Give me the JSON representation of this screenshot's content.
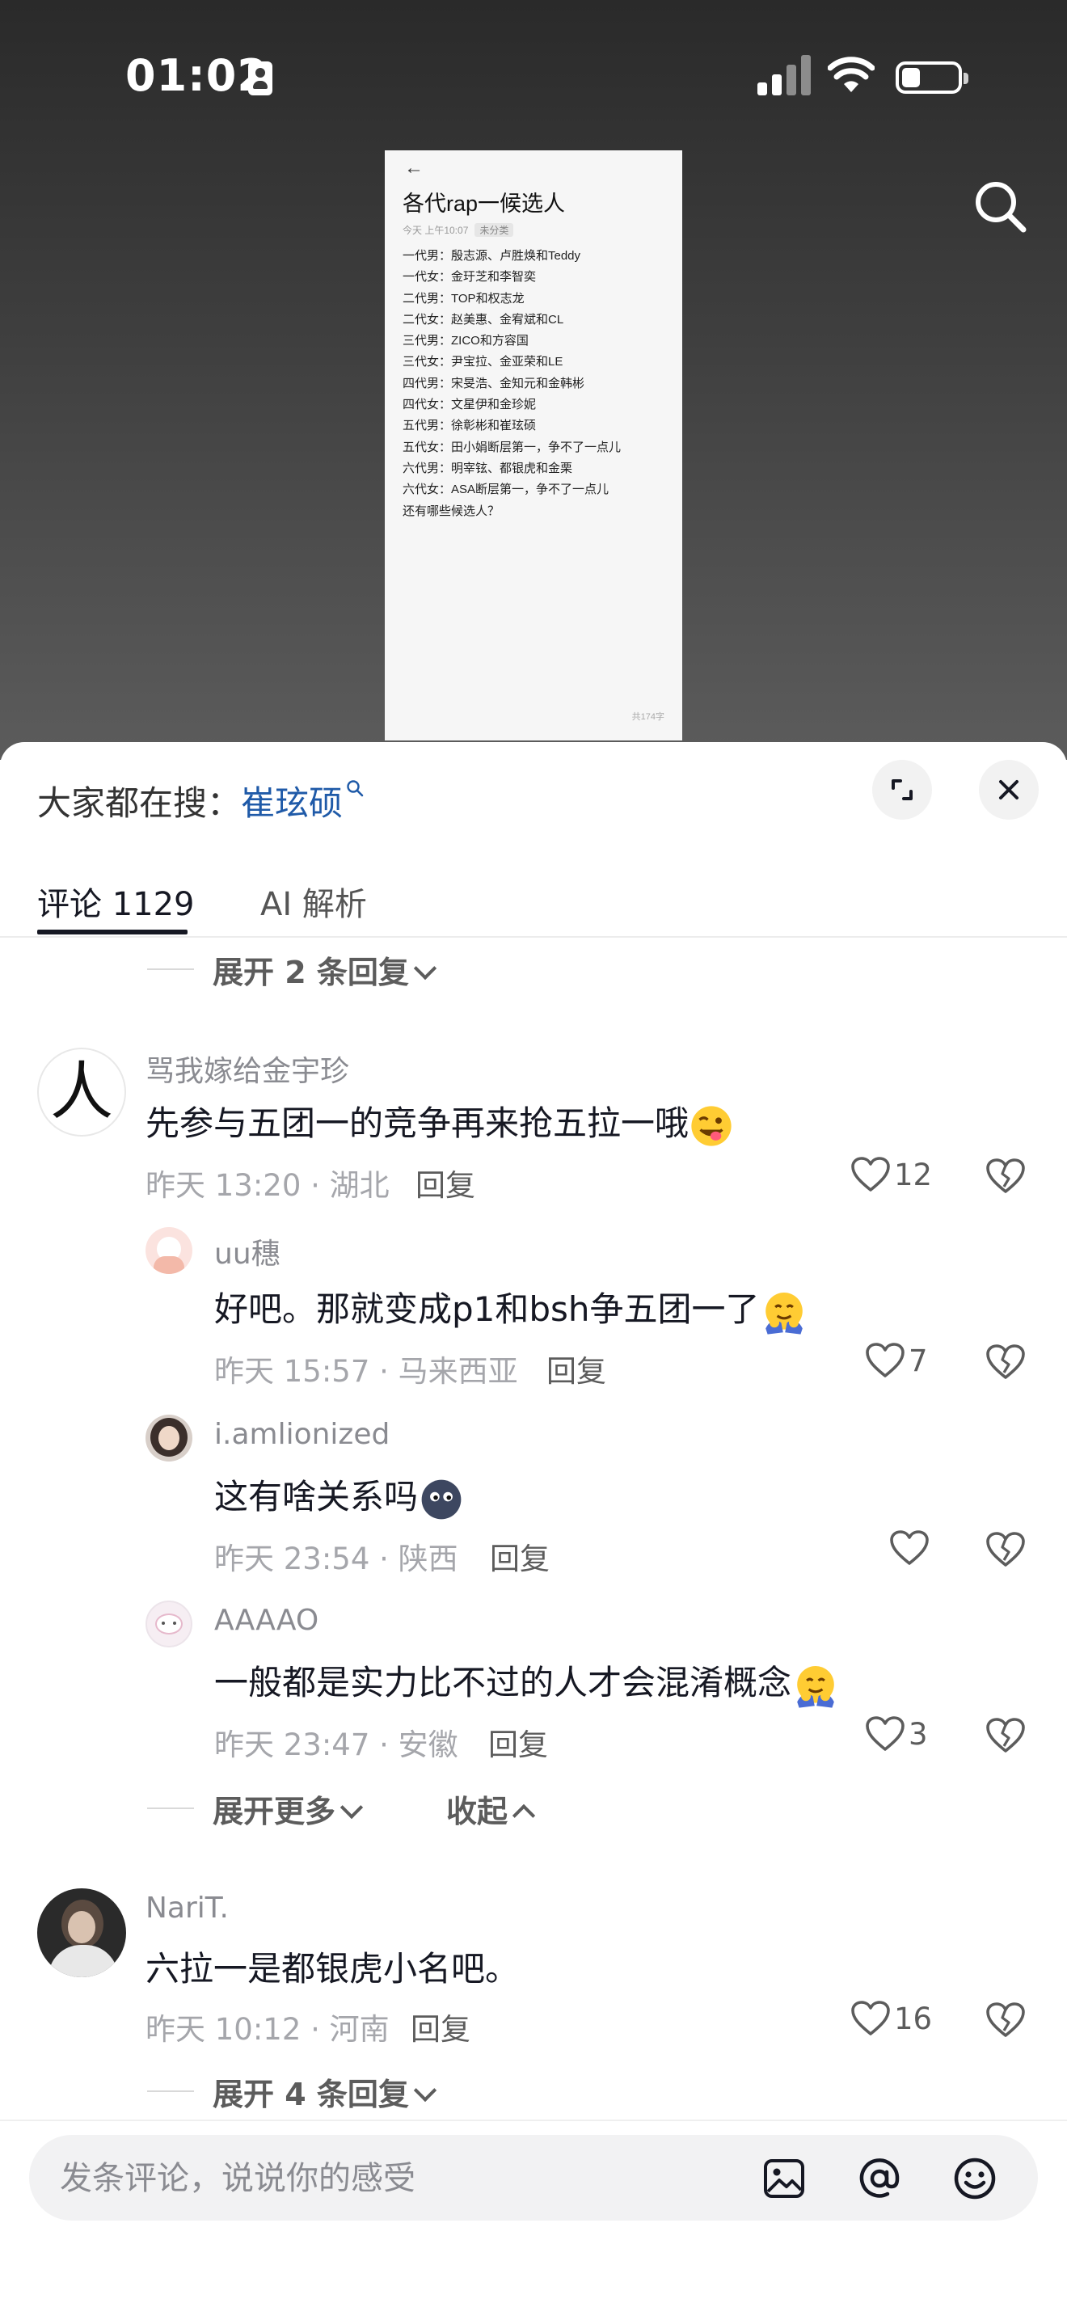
{
  "status_bar": {
    "time": "01:02"
  },
  "note": {
    "title": "各代rap一候选人",
    "meta": "今天 上午10:07",
    "meta_tag": "未分类",
    "lines": [
      "一代男：殷志源、卢胜焕和Teddy",
      "一代女：金玗芝和李智奕",
      "二代男：TOP和权志龙",
      "二代女：赵美惠、金宥斌和CL",
      "三代男：ZICO和方容国",
      "三代女：尹宝拉、金亚荣和LE",
      "四代男：宋旻浩、金知元和金韩彬",
      "四代女：文星伊和金珍妮",
      "五代男：徐彰彬和崔玹硕",
      "五代女：田小娟断层第一，争不了一点儿",
      "六代男：明宰铉、都银虎和金栗",
      "六代女：ASA断层第一，争不了一点儿",
      "还有哪些候选人？"
    ],
    "word_count": "共174字"
  },
  "sheet": {
    "search_prefix": "大家都在搜：",
    "search_keyword": "崔玹硕",
    "tabs": {
      "comments": "评论 1129",
      "ai": "AI 解析"
    }
  },
  "thread": {
    "expand_top": "展开 2 条回复",
    "comments": [
      {
        "username": "骂我嫁给金宇珍",
        "avatar_char": "人",
        "text": "先参与五团一的竞争再来抢五拉一哦",
        "meta": "昨天 13:20 · 湖北",
        "reply": "回复",
        "likes": "12"
      },
      {
        "username": "uu穗",
        "text": "好吧。那就变成p1和bsh争五团一了",
        "meta": "昨天 15:57 · 马来西亚",
        "reply": "回复",
        "likes": "7"
      },
      {
        "username": "i.amlionized",
        "text": "这有啥关系吗",
        "meta": "昨天 23:54 · 陕西",
        "reply": "回复",
        "likes": ""
      },
      {
        "username": "AAAAO",
        "text": "一般都是实力比不过的人才会混淆概念",
        "meta": "昨天 23:47 · 安徽",
        "reply": "回复",
        "likes": "3"
      },
      {
        "username": "NariT.",
        "text": "六拉一是都银虎小名吧。",
        "meta": "昨天 10:12 · 河南",
        "reply": "回复",
        "likes": "16"
      }
    ],
    "expand_more": "展开更多",
    "collapse": "收起",
    "expand_bottom": "展开 4 条回复"
  },
  "composer": {
    "placeholder": "发条评论，说说你的感受"
  },
  "colors": {
    "keyword": "#1f5aa8",
    "text": "#161823",
    "muted": "#a5a6ab"
  }
}
